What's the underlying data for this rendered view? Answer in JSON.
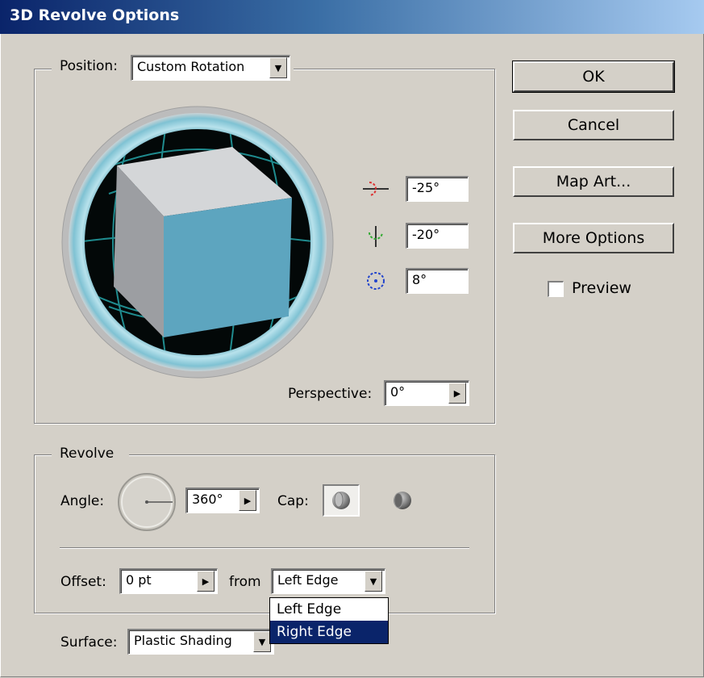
{
  "window": {
    "title": "3D Revolve Options"
  },
  "position": {
    "label": "Position:",
    "value": "Custom Rotation"
  },
  "rotation": {
    "x": "-25°",
    "y": "-20°",
    "z": "8°"
  },
  "perspective": {
    "label": "Perspective:",
    "value": "0°"
  },
  "revolve": {
    "group_label": "Revolve",
    "angle_label": "Angle:",
    "angle_value": "360°",
    "cap_label": "Cap:",
    "offset_label": "Offset:",
    "offset_value": "0 pt",
    "from_label": "from",
    "from_value": "Left Edge",
    "from_options": [
      "Left Edge",
      "Right Edge"
    ],
    "from_highlighted": "Right Edge"
  },
  "surface": {
    "label": "Surface:",
    "value": "Plastic Shading"
  },
  "buttons": {
    "ok": "OK",
    "cancel": "Cancel",
    "map_art": "Map Art...",
    "more_options": "More Options"
  },
  "preview": {
    "label": "Preview",
    "checked": false
  },
  "colors": {
    "title_start": "#0a246a",
    "cube_front": "#5da5bf",
    "cube_top": "#d4d6d8",
    "cube_side": "#9c9ea2",
    "track_ring": "#9ad0dc",
    "grid": "#1f8b8e"
  },
  "icons": [
    "x-axis-rotate-icon",
    "y-axis-rotate-icon",
    "z-axis-rotate-icon",
    "cap-on-icon",
    "cap-off-icon",
    "angle-dial-icon"
  ]
}
